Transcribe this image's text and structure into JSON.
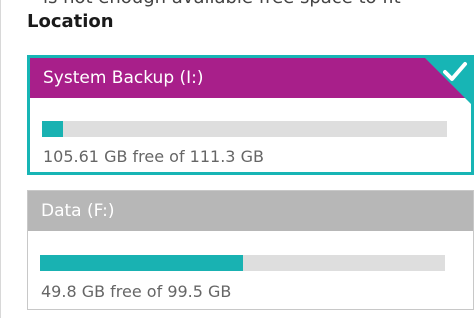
{
  "message": "is not enough available free space to fit",
  "location": {
    "title": "Location"
  },
  "drives": [
    {
      "label": "System Backup (I:)",
      "space_text": "105.61 GB free of 111.3 GB",
      "used_fraction": 0.051,
      "selected": true,
      "icon": "checkmark-icon"
    },
    {
      "label": "Data (F:)",
      "space_text": "49.8 GB free of 99.5 GB",
      "used_fraction": 0.5,
      "selected": false
    }
  ],
  "colors": {
    "selected_header": "#a81f8a",
    "unselected_header": "#b7b7b7",
    "accent": "#19b2b2",
    "track": "#dedede"
  }
}
